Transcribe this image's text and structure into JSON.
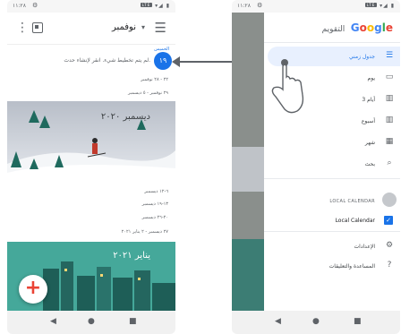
{
  "left_phone": {
    "status": {
      "time": "١١:٢٨",
      "right": "الإشارة"
    },
    "month_label": "نوفمبر",
    "today": {
      "label": "الخميس",
      "day": "١٩",
      "empty_text": "لم يتم تخطيط شيء. انقر لإنشاء حدث."
    },
    "weeks_nov": [
      "٢٢ - ٢٨ نوفمبر",
      "٢٩ نوفمبر - ٥ ديسمبر"
    ],
    "banner_dec": "ديسمبر ٢٠٢٠",
    "weeks_dec": [
      "٦-١٢ ديسمبر",
      "١٣-١٩ ديسمبر",
      "٢٠-٢٦ ديسمبر",
      "٢٧ ديسمبر - ٢ يناير ٢٠٢١"
    ],
    "banner_jan": "يناير ٢٠٢١",
    "fab_label": "+"
  },
  "right_phone": {
    "app_name": "التقويم",
    "logo": [
      "G",
      "o",
      "o",
      "g",
      "l",
      "e"
    ],
    "logo_colors": [
      "#4285f4",
      "#ea4335",
      "#fbbc05",
      "#4285f4",
      "#34a853",
      "#ea4335"
    ],
    "items": [
      {
        "label": "جدول زمني",
        "icon": "schedule-icon",
        "glyph": "☰"
      },
      {
        "label": "يوم",
        "icon": "day-icon",
        "glyph": "▭"
      },
      {
        "label": "3 أيام",
        "icon": "three-day-icon",
        "glyph": "▥"
      },
      {
        "label": "أسبوع",
        "icon": "week-icon",
        "glyph": "▥"
      },
      {
        "label": "شهر",
        "icon": "month-icon",
        "glyph": "▦"
      },
      {
        "label": "بحث",
        "icon": "search-icon",
        "glyph": "⌕"
      }
    ],
    "local_header": "LOCAL CALENDAR",
    "local_calendar": "Local Calendar",
    "settings": "الإعدادات",
    "help": "المساعدة والتعليقات"
  }
}
